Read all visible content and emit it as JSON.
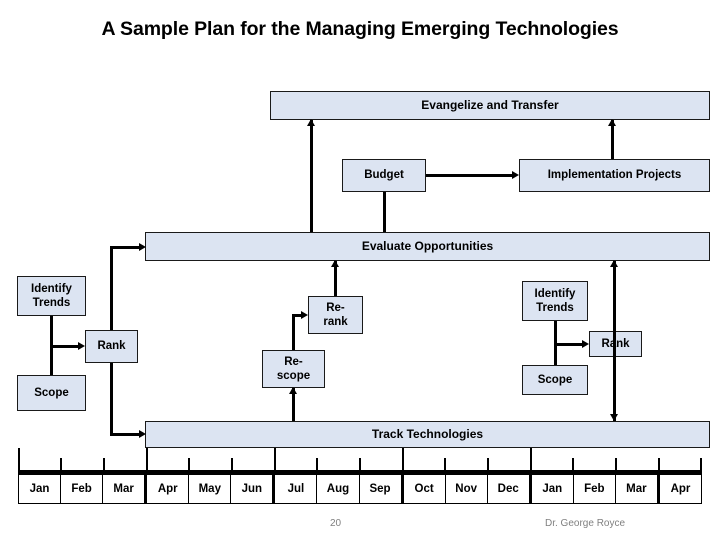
{
  "slide": {
    "title": "A Sample Plan for the Managing Emerging Technologies",
    "page_number": "20",
    "author": "Dr. George Royce",
    "colors": {
      "box_fill": "#dce4f2",
      "box_border": "#1a1a1a",
      "line": "#000000",
      "footer_text": "#808080",
      "background": "#ffffff"
    }
  },
  "boxes": {
    "evangelize": "Evangelize and Transfer",
    "budget": "Budget",
    "implementation": "Implementation Projects",
    "evaluate": "Evaluate Opportunities",
    "identify_trends_left": "Identify\nTrends",
    "rank_left": "Rank",
    "scope_left": "Scope",
    "rerank": "Re-\nrank",
    "rescope": "Re-\nscope",
    "identify_trends_right": "Identify\nTrends",
    "rank_right": "Rank",
    "scope_right": "Scope",
    "track": "Track Technologies"
  },
  "timeline": {
    "months": [
      "Jan",
      "Feb",
      "Mar",
      "Apr",
      "May",
      "Jun",
      "Jul",
      "Aug",
      "Sep",
      "Oct",
      "Nov",
      "Dec",
      "Jan",
      "Feb",
      "Mar",
      "Apr"
    ]
  }
}
